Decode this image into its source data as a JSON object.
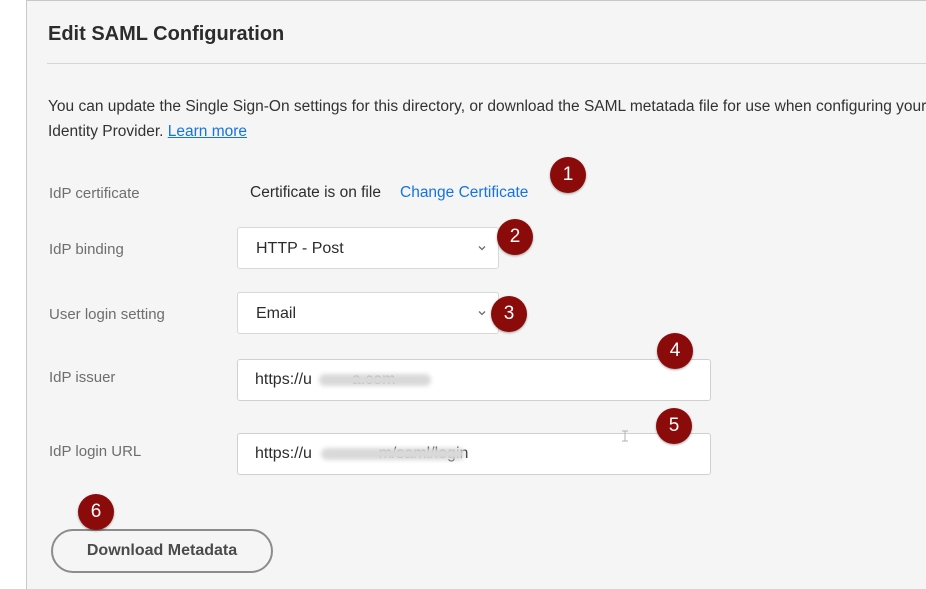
{
  "title": "Edit SAML Configuration",
  "description": {
    "text": "You can update the Single Sign-On settings for this directory, or download the SAML metatada file for use when configuring your Identity Provider.",
    "learn_more": "Learn more"
  },
  "certificate": {
    "label": "IdP certificate",
    "status": "Certificate is on file",
    "change_link": "Change Certificate"
  },
  "binding": {
    "label": "IdP binding",
    "value": "HTTP - Post"
  },
  "login_setting": {
    "label": "User login setting",
    "value": "Email"
  },
  "issuer": {
    "label": "IdP issuer",
    "value": "https://u         a.com"
  },
  "login_url": {
    "label": "IdP login URL",
    "value": "https://u               m/saml/login"
  },
  "download_button": "Download Metadata",
  "callouts": [
    "1",
    "2",
    "3",
    "4",
    "5",
    "6"
  ],
  "colors": {
    "panel_bg": "#f5f5f5",
    "link": "#1473e6",
    "callout": "#8b0b0b"
  },
  "icons": {
    "dropdown": "chevron-down-icon"
  }
}
